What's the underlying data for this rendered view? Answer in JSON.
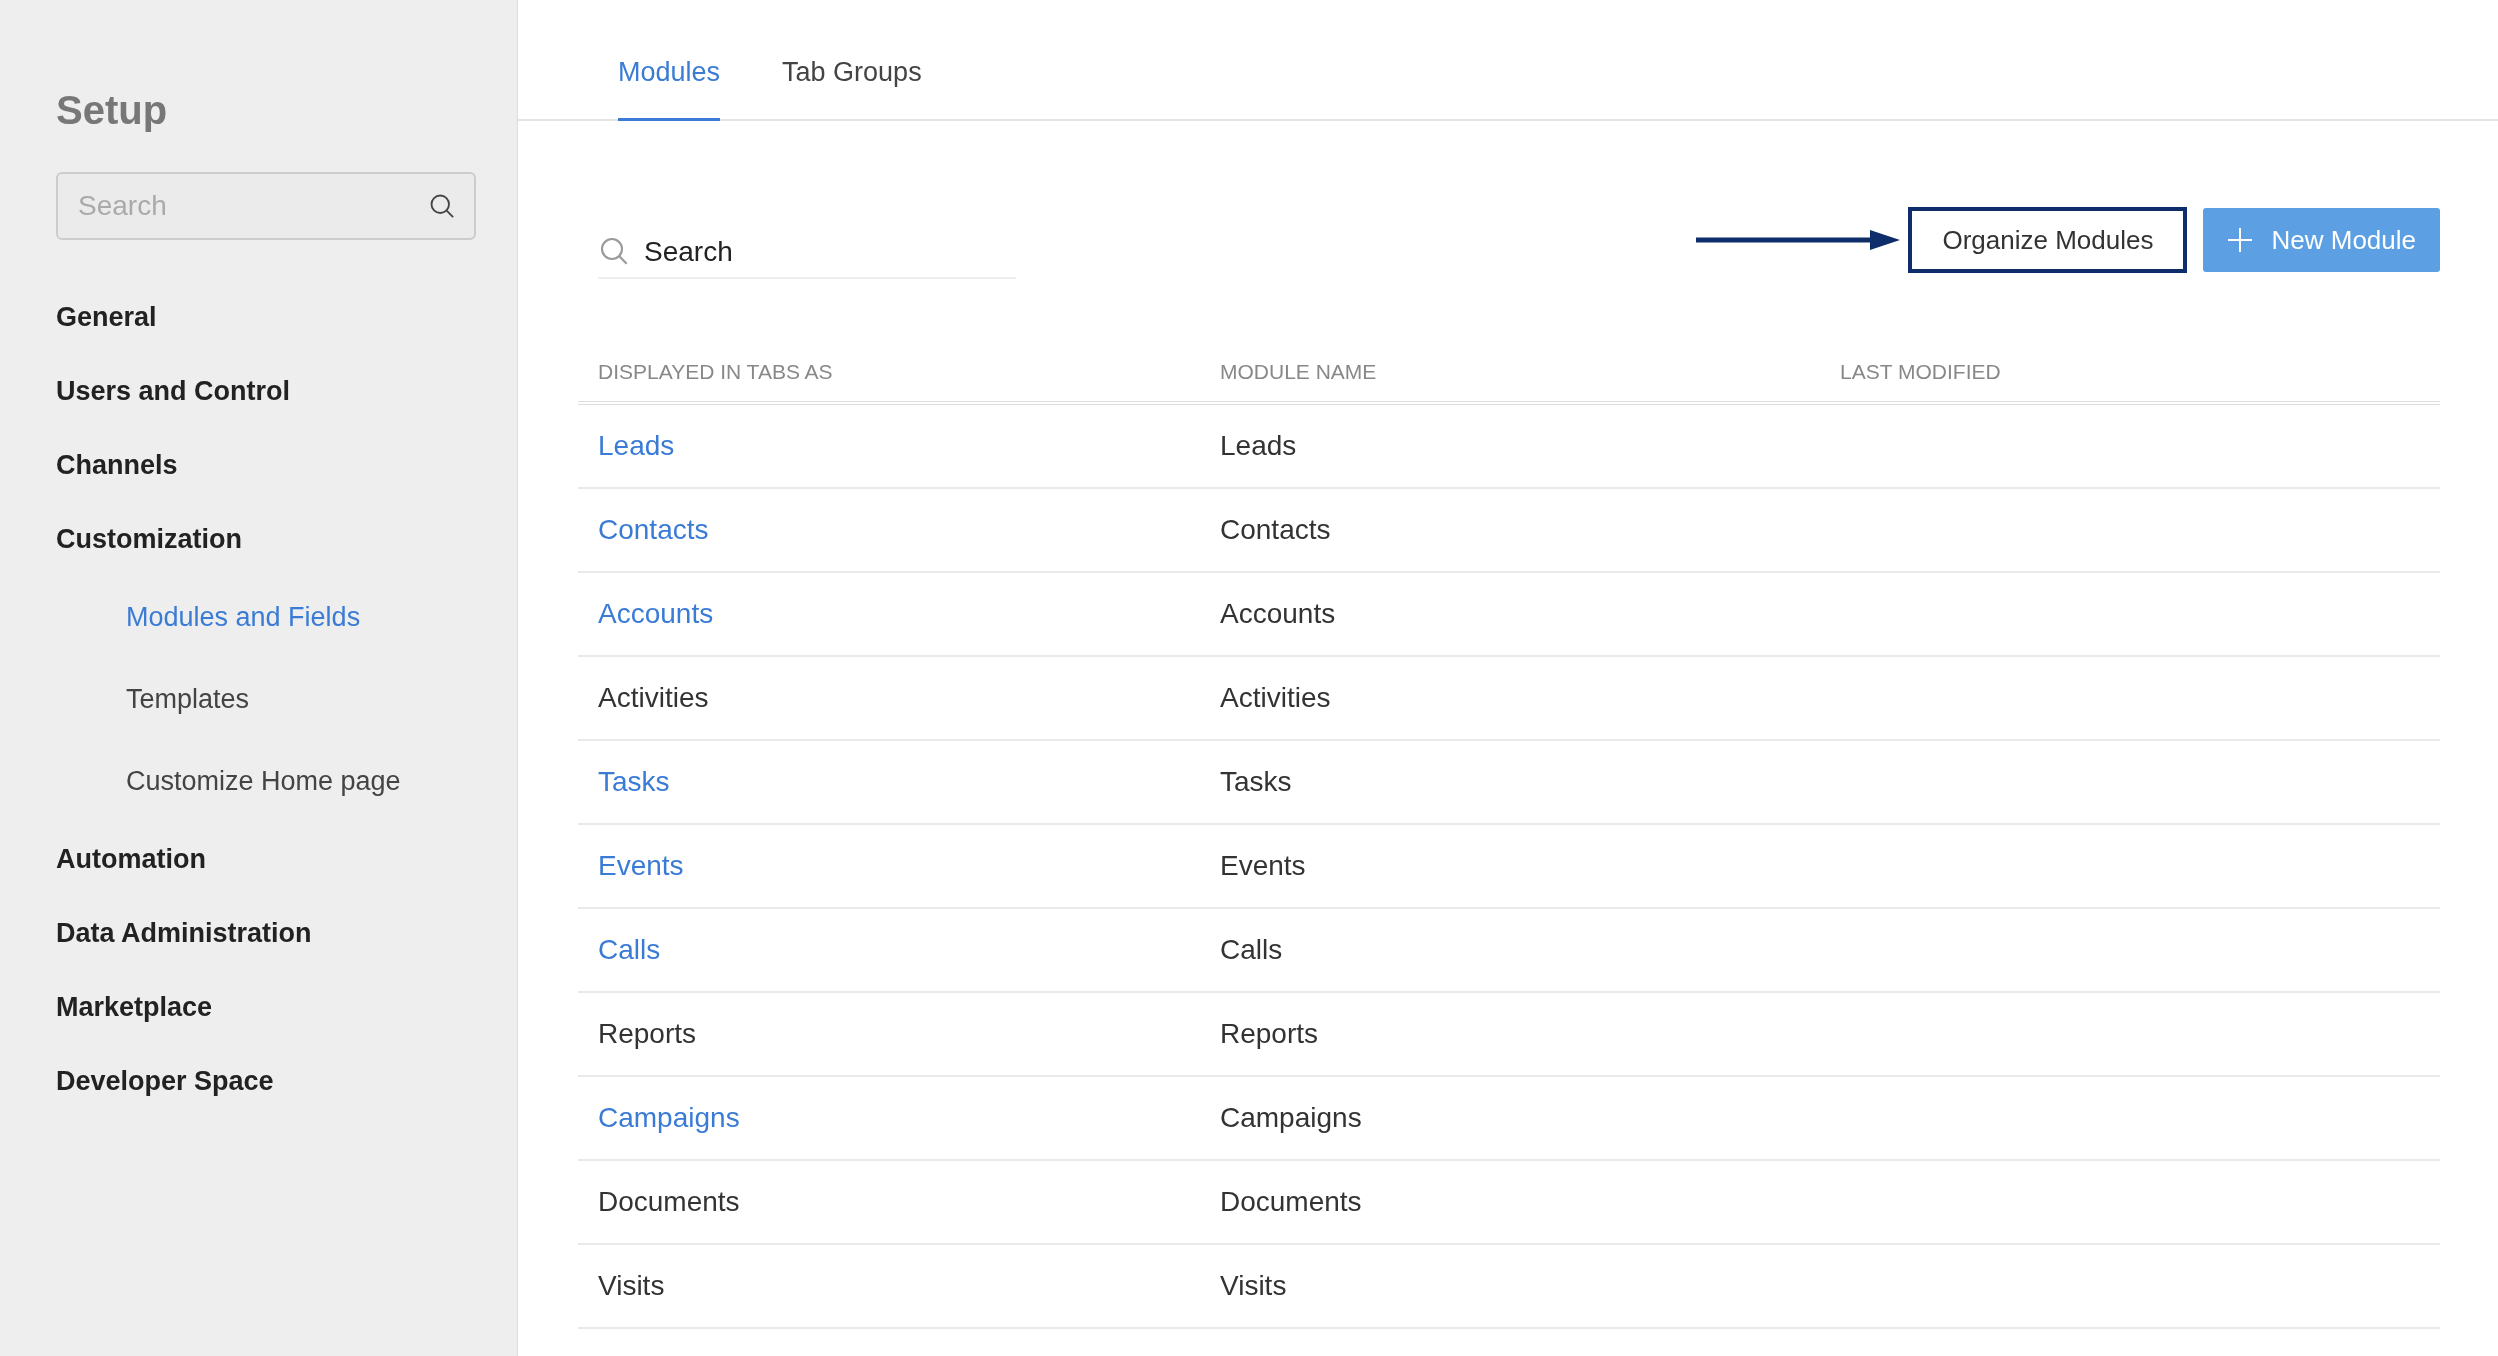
{
  "sidebar": {
    "title": "Setup",
    "search": {
      "placeholder": "Search"
    },
    "items": [
      {
        "label": "General",
        "selected": false
      },
      {
        "label": "Users and Control",
        "selected": false
      },
      {
        "label": "Channels",
        "selected": false
      },
      {
        "label": "Customization",
        "selected": false,
        "children": [
          {
            "label": "Modules and Fields",
            "selected": true
          },
          {
            "label": "Templates",
            "selected": false
          },
          {
            "label": "Customize Home page",
            "selected": false
          }
        ]
      },
      {
        "label": "Automation",
        "selected": false
      },
      {
        "label": "Data Administration",
        "selected": false
      },
      {
        "label": "Marketplace",
        "selected": false
      },
      {
        "label": "Developer Space",
        "selected": false
      }
    ]
  },
  "tabs": [
    {
      "label": "Modules",
      "selected": true
    },
    {
      "label": "Tab Groups",
      "selected": false
    }
  ],
  "search": {
    "placeholder": "Search"
  },
  "toolbar": {
    "organize_button": {
      "label": "Organize Modules",
      "highlighted": true
    },
    "new_button": {
      "label": "New Module"
    }
  },
  "table": {
    "columns": [
      "DISPLAYED IN TABS AS",
      "MODULE NAME",
      "LAST MODIFIED"
    ],
    "rows": [
      {
        "tab_name": "Leads",
        "link": true,
        "module_name": "Leads"
      },
      {
        "tab_name": "Contacts",
        "link": true,
        "module_name": "Contacts"
      },
      {
        "tab_name": "Accounts",
        "link": true,
        "module_name": "Accounts"
      },
      {
        "tab_name": "Activities",
        "link": false,
        "module_name": "Activities"
      },
      {
        "tab_name": "Tasks",
        "link": true,
        "module_name": "Tasks"
      },
      {
        "tab_name": "Events",
        "link": true,
        "module_name": "Events"
      },
      {
        "tab_name": "Calls",
        "link": true,
        "module_name": "Calls"
      },
      {
        "tab_name": "Reports",
        "link": false,
        "module_name": "Reports"
      },
      {
        "tab_name": "Campaigns",
        "link": true,
        "module_name": "Campaigns"
      },
      {
        "tab_name": "Documents",
        "link": false,
        "module_name": "Documents"
      },
      {
        "tab_name": "Visits",
        "link": false,
        "module_name": "Visits"
      }
    ]
  }
}
